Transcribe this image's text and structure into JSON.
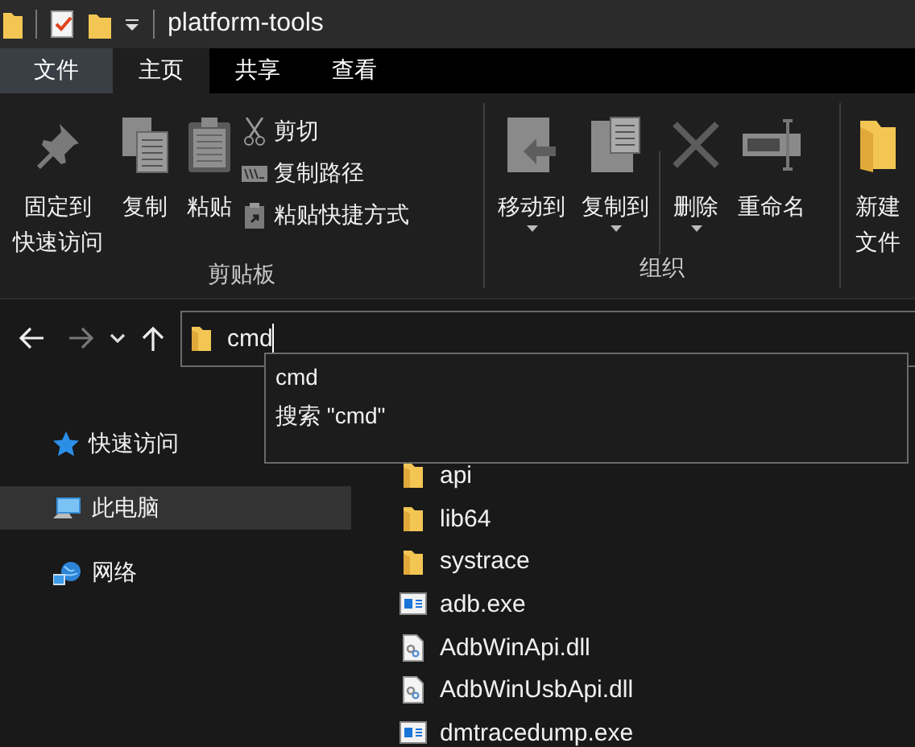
{
  "title_bar": {
    "title": "platform-tools"
  },
  "tabs": [
    {
      "label": "文件",
      "kind": "file",
      "selected": false
    },
    {
      "label": "主页",
      "kind": "tab",
      "selected": true
    },
    {
      "label": "共享",
      "kind": "tab",
      "selected": false
    },
    {
      "label": "查看",
      "kind": "tab",
      "selected": false
    }
  ],
  "ribbon": {
    "groups": [
      {
        "label": "剪贴板",
        "large_buttons": [
          {
            "label_lines": [
              "固定到",
              "快速访问"
            ],
            "has_menu": false
          },
          {
            "label_lines": [
              "复制"
            ],
            "has_menu": false
          },
          {
            "label_lines": [
              "粘贴"
            ],
            "has_menu": false
          }
        ],
        "small_buttons": [
          "剪切",
          "复制路径",
          "粘贴快捷方式"
        ]
      },
      {
        "label": "组织",
        "large_buttons": [
          {
            "label_lines": [
              "移动到"
            ],
            "has_menu": true
          },
          {
            "label_lines": [
              "复制到"
            ],
            "has_menu": true
          },
          {
            "label_lines": [
              "删除"
            ],
            "has_menu": true
          },
          {
            "label_lines": [
              "重命名"
            ],
            "has_menu": false
          }
        ]
      },
      {
        "large_buttons": [
          {
            "label_lines": [
              "新建",
              "文件"
            ],
            "has_menu": false
          }
        ]
      }
    ]
  },
  "navigation": {
    "forward_disabled": true,
    "address": {
      "value": "cmd"
    },
    "suggestions": [
      "cmd",
      "搜索 \"cmd\""
    ]
  },
  "sidebar": {
    "items": [
      {
        "label": "快速访问",
        "selected": false
      },
      {
        "label": "此电脑",
        "selected": true
      },
      {
        "label": "网络",
        "selected": false
      }
    ]
  },
  "files": [
    {
      "name": "api",
      "kind": "folder"
    },
    {
      "name": "lib64",
      "kind": "folder"
    },
    {
      "name": "systrace",
      "kind": "folder"
    },
    {
      "name": "adb.exe",
      "kind": "exe"
    },
    {
      "name": "AdbWinApi.dll",
      "kind": "dll"
    },
    {
      "name": "AdbWinUsbApi.dll",
      "kind": "dll"
    },
    {
      "name": "dmtracedump.exe",
      "kind": "exe"
    }
  ]
}
